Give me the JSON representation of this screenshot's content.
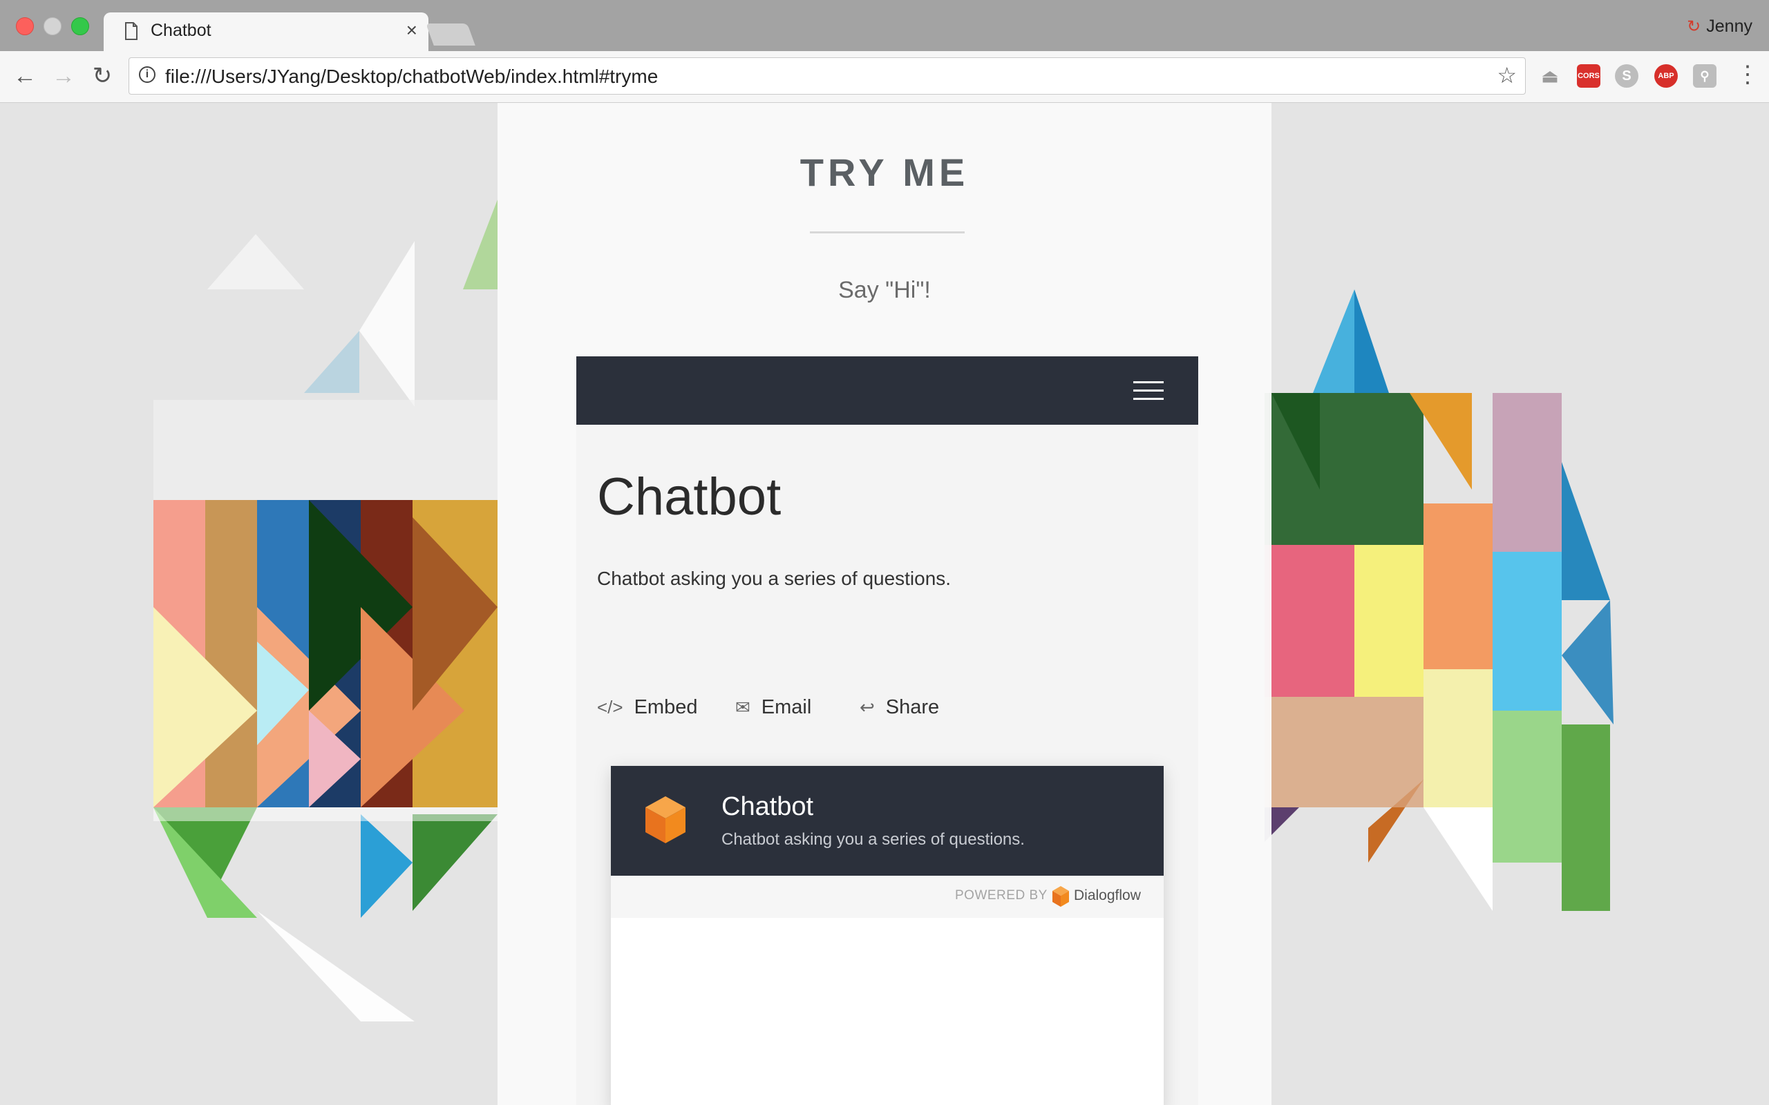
{
  "browser": {
    "tab_title": "Chatbot",
    "tab_close": "×",
    "profile_name": "Jenny",
    "url": "file:///Users/JYang/Desktop/chatbotWeb/index.html#tryme",
    "extensions": [
      "drive-icon",
      "cors-icon",
      "skype-icon",
      "adblock-icon",
      "pin-icon"
    ],
    "cors_label": "CORS",
    "abp_label": "ABP"
  },
  "section": {
    "heading": "TRY ME",
    "prompt": "Say \"Hi\"!"
  },
  "card": {
    "title": "Chatbot",
    "description": "Chatbot asking you a series of questions.",
    "actions": {
      "embed": "Embed",
      "email": "Email",
      "share": "Share"
    }
  },
  "widget": {
    "title": "Chatbot",
    "subtitle": "Chatbot asking you a series of questions.",
    "powered_by": "POWERED BY",
    "brand": "Dialogflow"
  },
  "colors": {
    "dark_bar": "#2b303b",
    "accent_orange": "#f28a1e"
  }
}
